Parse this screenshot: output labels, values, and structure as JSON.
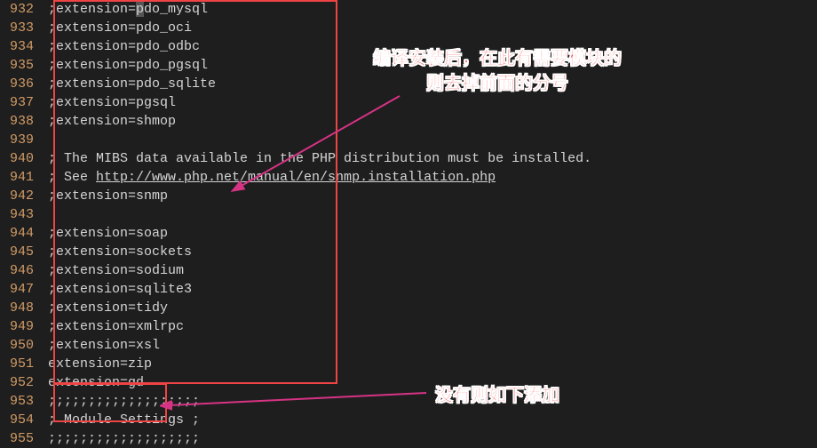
{
  "lines": [
    {
      "num": 932,
      "segments": [
        {
          "t": ";extension="
        },
        {
          "t": "p",
          "cursor": true
        },
        {
          "t": "do_mysql"
        }
      ]
    },
    {
      "num": 933,
      "segments": [
        {
          "t": ";extension=pdo_oci"
        }
      ]
    },
    {
      "num": 934,
      "segments": [
        {
          "t": ";extension=pdo_odbc"
        }
      ]
    },
    {
      "num": 935,
      "segments": [
        {
          "t": ";extension=pdo_pgsql"
        }
      ]
    },
    {
      "num": 936,
      "segments": [
        {
          "t": ";extension=pdo_sqlite"
        }
      ]
    },
    {
      "num": 937,
      "segments": [
        {
          "t": ";extension=pgsql"
        }
      ]
    },
    {
      "num": 938,
      "segments": [
        {
          "t": ";extension=shmop"
        }
      ]
    },
    {
      "num": 939,
      "segments": [
        {
          "t": ""
        }
      ]
    },
    {
      "num": 940,
      "segments": [
        {
          "t": "; The MIBS data available in the PHP distribution must be installed."
        }
      ]
    },
    {
      "num": 941,
      "segments": [
        {
          "t": "; See "
        },
        {
          "t": "http://www.php.net/manual/en/snmp.installation.php",
          "link": true
        }
      ]
    },
    {
      "num": 942,
      "segments": [
        {
          "t": ";extension=snmp"
        }
      ]
    },
    {
      "num": 943,
      "segments": [
        {
          "t": ""
        }
      ]
    },
    {
      "num": 944,
      "segments": [
        {
          "t": ";extension=soap"
        }
      ]
    },
    {
      "num": 945,
      "segments": [
        {
          "t": ";extension=sockets"
        }
      ]
    },
    {
      "num": 946,
      "segments": [
        {
          "t": ";extension=sodium"
        }
      ]
    },
    {
      "num": 947,
      "segments": [
        {
          "t": ";extension=sqlite3"
        }
      ]
    },
    {
      "num": 948,
      "segments": [
        {
          "t": ";extension=tidy"
        }
      ]
    },
    {
      "num": 949,
      "segments": [
        {
          "t": ";extension=xmlrpc"
        }
      ]
    },
    {
      "num": 950,
      "segments": [
        {
          "t": ";extension=xsl"
        }
      ]
    },
    {
      "num": 951,
      "segments": [
        {
          "t": "extension=zip"
        }
      ]
    },
    {
      "num": 952,
      "segments": [
        {
          "t": "extension=gd"
        }
      ]
    },
    {
      "num": 953,
      "segments": [
        {
          "t": ";;;;;;;;;;;;;;;;;;;"
        }
      ]
    },
    {
      "num": 954,
      "segments": [
        {
          "t": "; Module Settings ;"
        }
      ]
    },
    {
      "num": 955,
      "segments": [
        {
          "t": ";;;;;;;;;;;;;;;;;;;"
        }
      ]
    }
  ],
  "annotations": {
    "top_line1": "编译安装后，在此有需要模块的",
    "top_line2": "则去掉前面的分号",
    "bottom": "没有则如下添加"
  },
  "arrow_color": "#d63384"
}
